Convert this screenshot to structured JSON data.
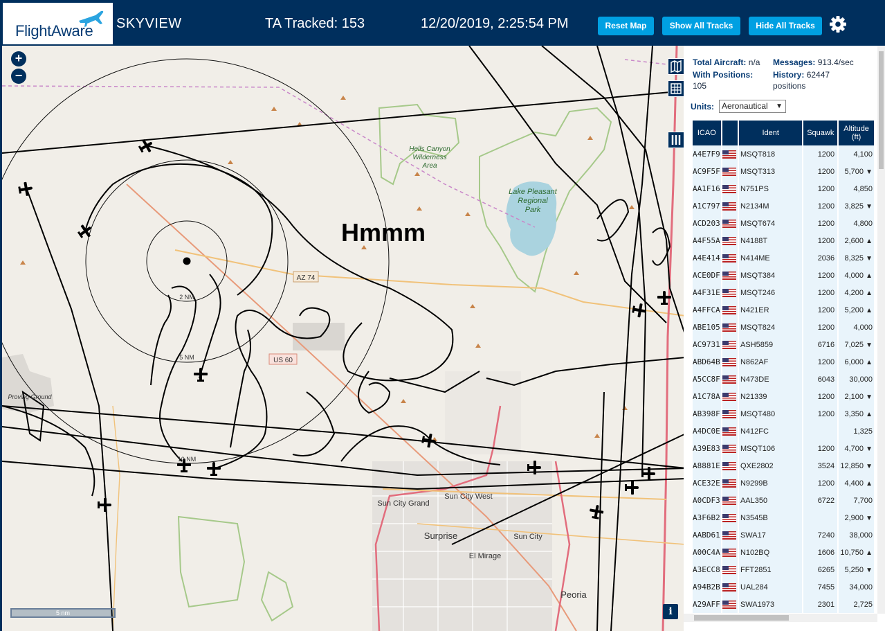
{
  "header": {
    "logo": "FlightAware",
    "app_title": "SKYVIEW",
    "ta_tracked": "TA Tracked: 153",
    "clock": "12/20/2019, 2:25:54 PM",
    "reset_map": "Reset Map",
    "show_all_tracks": "Show All Tracks",
    "hide_all_tracks": "Hide All Tracks"
  },
  "map": {
    "zoom_in": "+",
    "zoom_out": "−",
    "annotation": "Hmmm",
    "labels": {
      "hells_canyon": "Hells Canyon",
      "wilderness": "Wilderness",
      "area": "Area",
      "lake_pleasant": "Lake Pleasant",
      "regional": "Regional",
      "park": "Park",
      "az74": "AZ 74",
      "us60": "US 60",
      "ring_2nm": "2 NM",
      "ring_5nm": "5 NM",
      "ring_10nm": "10 NM",
      "sun_city_grand": "Sun City Grand",
      "sun_city_west": "Sun City West",
      "surprise": "Surprise",
      "sun_city": "Sun City",
      "el_mirage": "El Mirage",
      "peoria": "Peoria",
      "proving_ground": "Proving Ground"
    },
    "scale": "5 nm",
    "info": "i"
  },
  "stats": {
    "total_aircraft_label": "Total Aircraft:",
    "total_aircraft_value": "n/a",
    "messages_label": "Messages:",
    "messages_value": "913.4/sec",
    "with_positions_label": "With Positions:",
    "with_positions_value": "105",
    "history_label": "History:",
    "history_value": "62447",
    "history_unit": "positions",
    "units_label": "Units:",
    "units_value": "Aeronautical"
  },
  "table": {
    "headers": [
      "ICAO",
      "",
      "Ident",
      "Squawk",
      "Altitude (ft)"
    ],
    "rows": [
      {
        "icao": "A4E7F9",
        "ident": "MSQT818",
        "squawk": "1200",
        "alt": "4,100",
        "trend": ""
      },
      {
        "icao": "AC9F5F",
        "ident": "MSQT313",
        "squawk": "1200",
        "alt": "5,700",
        "trend": "▼"
      },
      {
        "icao": "AA1F16",
        "ident": "N751PS",
        "squawk": "1200",
        "alt": "4,850",
        "trend": ""
      },
      {
        "icao": "A1C797",
        "ident": "N2134M",
        "squawk": "1200",
        "alt": "3,825",
        "trend": "▼"
      },
      {
        "icao": "ACD203",
        "ident": "MSQT674",
        "squawk": "1200",
        "alt": "4,800",
        "trend": ""
      },
      {
        "icao": "A4F55A",
        "ident": "N4188T",
        "squawk": "1200",
        "alt": "2,600",
        "trend": "▲"
      },
      {
        "icao": "A4E414",
        "ident": "N414ME",
        "squawk": "2036",
        "alt": "8,325",
        "trend": "▼"
      },
      {
        "icao": "ACE0DF",
        "ident": "MSQT384",
        "squawk": "1200",
        "alt": "4,000",
        "trend": "▲"
      },
      {
        "icao": "A4F31E",
        "ident": "MSQT246",
        "squawk": "1200",
        "alt": "4,200",
        "trend": "▲"
      },
      {
        "icao": "A4FFCA",
        "ident": "N421ER",
        "squawk": "1200",
        "alt": "5,200",
        "trend": "▲"
      },
      {
        "icao": "ABE105",
        "ident": "MSQT824",
        "squawk": "1200",
        "alt": "4,000",
        "trend": ""
      },
      {
        "icao": "AC9731",
        "ident": "ASH5859",
        "squawk": "6716",
        "alt": "7,025",
        "trend": "▼"
      },
      {
        "icao": "ABD64B",
        "ident": "N862AF",
        "squawk": "1200",
        "alt": "6,000",
        "trend": "▲"
      },
      {
        "icao": "A5CC8F",
        "ident": "N473DE",
        "squawk": "6043",
        "alt": "30,000",
        "trend": ""
      },
      {
        "icao": "A1C78A",
        "ident": "N21339",
        "squawk": "1200",
        "alt": "2,100",
        "trend": "▼"
      },
      {
        "icao": "AB398F",
        "ident": "MSQT480",
        "squawk": "1200",
        "alt": "3,350",
        "trend": "▲"
      },
      {
        "icao": "A4DC0E",
        "ident": "N412FC",
        "squawk": "",
        "alt": "1,325",
        "trend": ""
      },
      {
        "icao": "A39E83",
        "ident": "MSQT106",
        "squawk": "1200",
        "alt": "4,700",
        "trend": "▼"
      },
      {
        "icao": "A8881E",
        "ident": "QXE2802",
        "squawk": "3524",
        "alt": "12,850",
        "trend": "▼"
      },
      {
        "icao": "ACE32E",
        "ident": "N9299B",
        "squawk": "1200",
        "alt": "4,400",
        "trend": "▲"
      },
      {
        "icao": "A0CDF3",
        "ident": "AAL350",
        "squawk": "6722",
        "alt": "7,700",
        "trend": ""
      },
      {
        "icao": "A3F6B2",
        "ident": "N3545B",
        "squawk": "",
        "alt": "2,900",
        "trend": "▼"
      },
      {
        "icao": "AABD61",
        "ident": "SWA17",
        "squawk": "7240",
        "alt": "38,000",
        "trend": ""
      },
      {
        "icao": "A00C4A",
        "ident": "N102BQ",
        "squawk": "1606",
        "alt": "10,750",
        "trend": "▲"
      },
      {
        "icao": "A3ECC8",
        "ident": "FFT2851",
        "squawk": "6265",
        "alt": "5,250",
        "trend": "▼"
      },
      {
        "icao": "A94B2B",
        "ident": "UAL284",
        "squawk": "7455",
        "alt": "34,000",
        "trend": ""
      },
      {
        "icao": "A29AFF",
        "ident": "SWA1973",
        "squawk": "2301",
        "alt": "2,725",
        "trend": ""
      }
    ]
  },
  "colors": {
    "header_bg": "#002f5d",
    "button_bg": "#00a0e2",
    "row_bg": "#e9f4fb",
    "map_bg": "#f1eee8",
    "lake": "#aad3df",
    "park_border": "#a6c98a"
  },
  "icons": {
    "logo_plane": "plane-icon",
    "gear": "gear-icon",
    "layers": "map-layers-icon",
    "grid": "grid-icon",
    "columns": "columns-icon"
  }
}
